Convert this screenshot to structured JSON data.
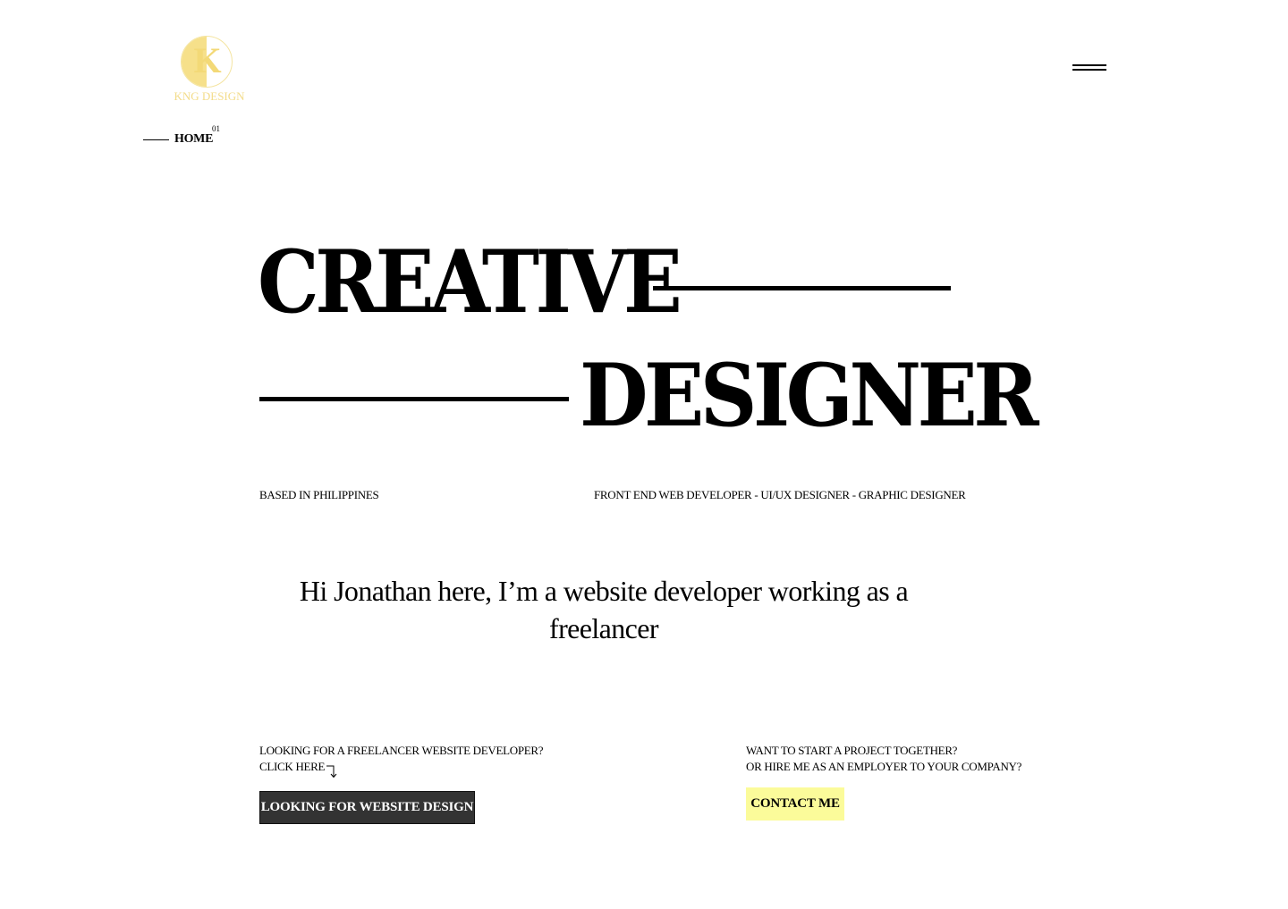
{
  "logo": {
    "monogram": "K",
    "text": "KNG DESIGN"
  },
  "menu": {
    "icon": "hamburger-icon"
  },
  "nav": {
    "label": "HOME",
    "number": "01"
  },
  "hero": {
    "word1": "CREATIVE",
    "word2": "DESIGNER"
  },
  "tagline": {
    "location": "BASED IN PHILIPPINES",
    "roles": "FRONT END WEB DEVELOPER - UI/UX DESIGNER - GRAPHIC DESIGNER"
  },
  "intro": "Hi Jonathan here, I’m a website developer working as a freelancer",
  "cta_left": {
    "line1": "LOOKING FOR A FREELANCER WEBSITE DEVELOPER?",
    "line2": "CLICK HERE",
    "arrow_icon": "arrow-turn-down-icon",
    "button": "LOOKING FOR WEBSITE DESIGN"
  },
  "cta_right": {
    "line1": "WANT TO START A PROJECT TOGETHER?",
    "line2": "OR HIRE ME AS AN EMPLOYER TO YOUR COMPANY?",
    "button": "CONTACT ME"
  },
  "colors": {
    "accent_yellow": "#fbfb9a",
    "logo_gold": "#f3d977",
    "dark_button": "#333333"
  }
}
